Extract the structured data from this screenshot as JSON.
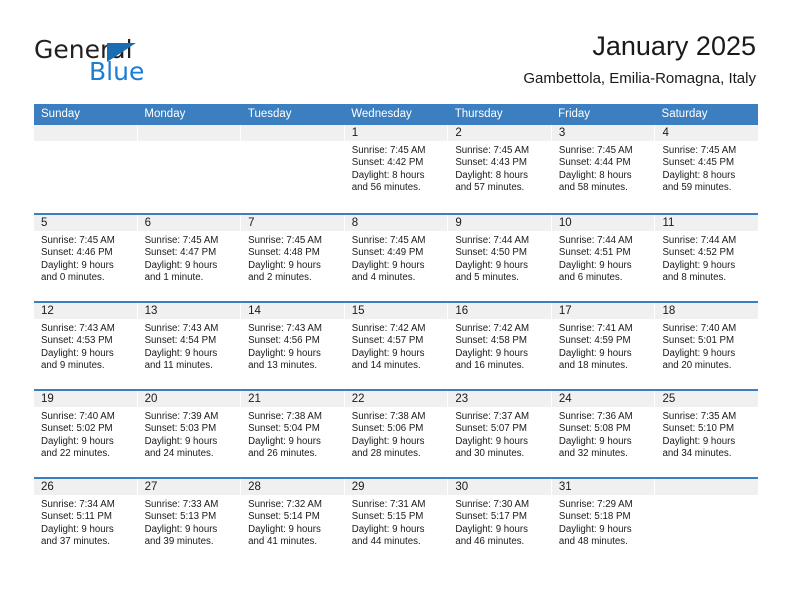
{
  "logo": {
    "text_primary": "General",
    "text_secondary": "Blue",
    "triangle_color": "#1b6cb0",
    "secondary_color": "#1b7dd4"
  },
  "header": {
    "title": "January 2025",
    "subtitle": "Gambettola, Emilia-Romagna, Italy"
  },
  "theme": {
    "header_blue": "#3c7fc0",
    "daynum_bg": "#f0f0f0",
    "text": "#1a1a1a"
  },
  "calendar": {
    "day_names": [
      "Sunday",
      "Monday",
      "Tuesday",
      "Wednesday",
      "Thursday",
      "Friday",
      "Saturday"
    ],
    "weeks": [
      [
        {
          "day": "",
          "lines": []
        },
        {
          "day": "",
          "lines": []
        },
        {
          "day": "",
          "lines": []
        },
        {
          "day": "1",
          "lines": [
            "Sunrise: 7:45 AM",
            "Sunset: 4:42 PM",
            "Daylight: 8 hours",
            "and 56 minutes."
          ]
        },
        {
          "day": "2",
          "lines": [
            "Sunrise: 7:45 AM",
            "Sunset: 4:43 PM",
            "Daylight: 8 hours",
            "and 57 minutes."
          ]
        },
        {
          "day": "3",
          "lines": [
            "Sunrise: 7:45 AM",
            "Sunset: 4:44 PM",
            "Daylight: 8 hours",
            "and 58 minutes."
          ]
        },
        {
          "day": "4",
          "lines": [
            "Sunrise: 7:45 AM",
            "Sunset: 4:45 PM",
            "Daylight: 8 hours",
            "and 59 minutes."
          ]
        }
      ],
      [
        {
          "day": "5",
          "lines": [
            "Sunrise: 7:45 AM",
            "Sunset: 4:46 PM",
            "Daylight: 9 hours",
            "and 0 minutes."
          ]
        },
        {
          "day": "6",
          "lines": [
            "Sunrise: 7:45 AM",
            "Sunset: 4:47 PM",
            "Daylight: 9 hours",
            "and 1 minute."
          ]
        },
        {
          "day": "7",
          "lines": [
            "Sunrise: 7:45 AM",
            "Sunset: 4:48 PM",
            "Daylight: 9 hours",
            "and 2 minutes."
          ]
        },
        {
          "day": "8",
          "lines": [
            "Sunrise: 7:45 AM",
            "Sunset: 4:49 PM",
            "Daylight: 9 hours",
            "and 4 minutes."
          ]
        },
        {
          "day": "9",
          "lines": [
            "Sunrise: 7:44 AM",
            "Sunset: 4:50 PM",
            "Daylight: 9 hours",
            "and 5 minutes."
          ]
        },
        {
          "day": "10",
          "lines": [
            "Sunrise: 7:44 AM",
            "Sunset: 4:51 PM",
            "Daylight: 9 hours",
            "and 6 minutes."
          ]
        },
        {
          "day": "11",
          "lines": [
            "Sunrise: 7:44 AM",
            "Sunset: 4:52 PM",
            "Daylight: 9 hours",
            "and 8 minutes."
          ]
        }
      ],
      [
        {
          "day": "12",
          "lines": [
            "Sunrise: 7:43 AM",
            "Sunset: 4:53 PM",
            "Daylight: 9 hours",
            "and 9 minutes."
          ]
        },
        {
          "day": "13",
          "lines": [
            "Sunrise: 7:43 AM",
            "Sunset: 4:54 PM",
            "Daylight: 9 hours",
            "and 11 minutes."
          ]
        },
        {
          "day": "14",
          "lines": [
            "Sunrise: 7:43 AM",
            "Sunset: 4:56 PM",
            "Daylight: 9 hours",
            "and 13 minutes."
          ]
        },
        {
          "day": "15",
          "lines": [
            "Sunrise: 7:42 AM",
            "Sunset: 4:57 PM",
            "Daylight: 9 hours",
            "and 14 minutes."
          ]
        },
        {
          "day": "16",
          "lines": [
            "Sunrise: 7:42 AM",
            "Sunset: 4:58 PM",
            "Daylight: 9 hours",
            "and 16 minutes."
          ]
        },
        {
          "day": "17",
          "lines": [
            "Sunrise: 7:41 AM",
            "Sunset: 4:59 PM",
            "Daylight: 9 hours",
            "and 18 minutes."
          ]
        },
        {
          "day": "18",
          "lines": [
            "Sunrise: 7:40 AM",
            "Sunset: 5:01 PM",
            "Daylight: 9 hours",
            "and 20 minutes."
          ]
        }
      ],
      [
        {
          "day": "19",
          "lines": [
            "Sunrise: 7:40 AM",
            "Sunset: 5:02 PM",
            "Daylight: 9 hours",
            "and 22 minutes."
          ]
        },
        {
          "day": "20",
          "lines": [
            "Sunrise: 7:39 AM",
            "Sunset: 5:03 PM",
            "Daylight: 9 hours",
            "and 24 minutes."
          ]
        },
        {
          "day": "21",
          "lines": [
            "Sunrise: 7:38 AM",
            "Sunset: 5:04 PM",
            "Daylight: 9 hours",
            "and 26 minutes."
          ]
        },
        {
          "day": "22",
          "lines": [
            "Sunrise: 7:38 AM",
            "Sunset: 5:06 PM",
            "Daylight: 9 hours",
            "and 28 minutes."
          ]
        },
        {
          "day": "23",
          "lines": [
            "Sunrise: 7:37 AM",
            "Sunset: 5:07 PM",
            "Daylight: 9 hours",
            "and 30 minutes."
          ]
        },
        {
          "day": "24",
          "lines": [
            "Sunrise: 7:36 AM",
            "Sunset: 5:08 PM",
            "Daylight: 9 hours",
            "and 32 minutes."
          ]
        },
        {
          "day": "25",
          "lines": [
            "Sunrise: 7:35 AM",
            "Sunset: 5:10 PM",
            "Daylight: 9 hours",
            "and 34 minutes."
          ]
        }
      ],
      [
        {
          "day": "26",
          "lines": [
            "Sunrise: 7:34 AM",
            "Sunset: 5:11 PM",
            "Daylight: 9 hours",
            "and 37 minutes."
          ]
        },
        {
          "day": "27",
          "lines": [
            "Sunrise: 7:33 AM",
            "Sunset: 5:13 PM",
            "Daylight: 9 hours",
            "and 39 minutes."
          ]
        },
        {
          "day": "28",
          "lines": [
            "Sunrise: 7:32 AM",
            "Sunset: 5:14 PM",
            "Daylight: 9 hours",
            "and 41 minutes."
          ]
        },
        {
          "day": "29",
          "lines": [
            "Sunrise: 7:31 AM",
            "Sunset: 5:15 PM",
            "Daylight: 9 hours",
            "and 44 minutes."
          ]
        },
        {
          "day": "30",
          "lines": [
            "Sunrise: 7:30 AM",
            "Sunset: 5:17 PM",
            "Daylight: 9 hours",
            "and 46 minutes."
          ]
        },
        {
          "day": "31",
          "lines": [
            "Sunrise: 7:29 AM",
            "Sunset: 5:18 PM",
            "Daylight: 9 hours",
            "and 48 minutes."
          ]
        },
        {
          "day": "",
          "lines": []
        }
      ]
    ]
  }
}
